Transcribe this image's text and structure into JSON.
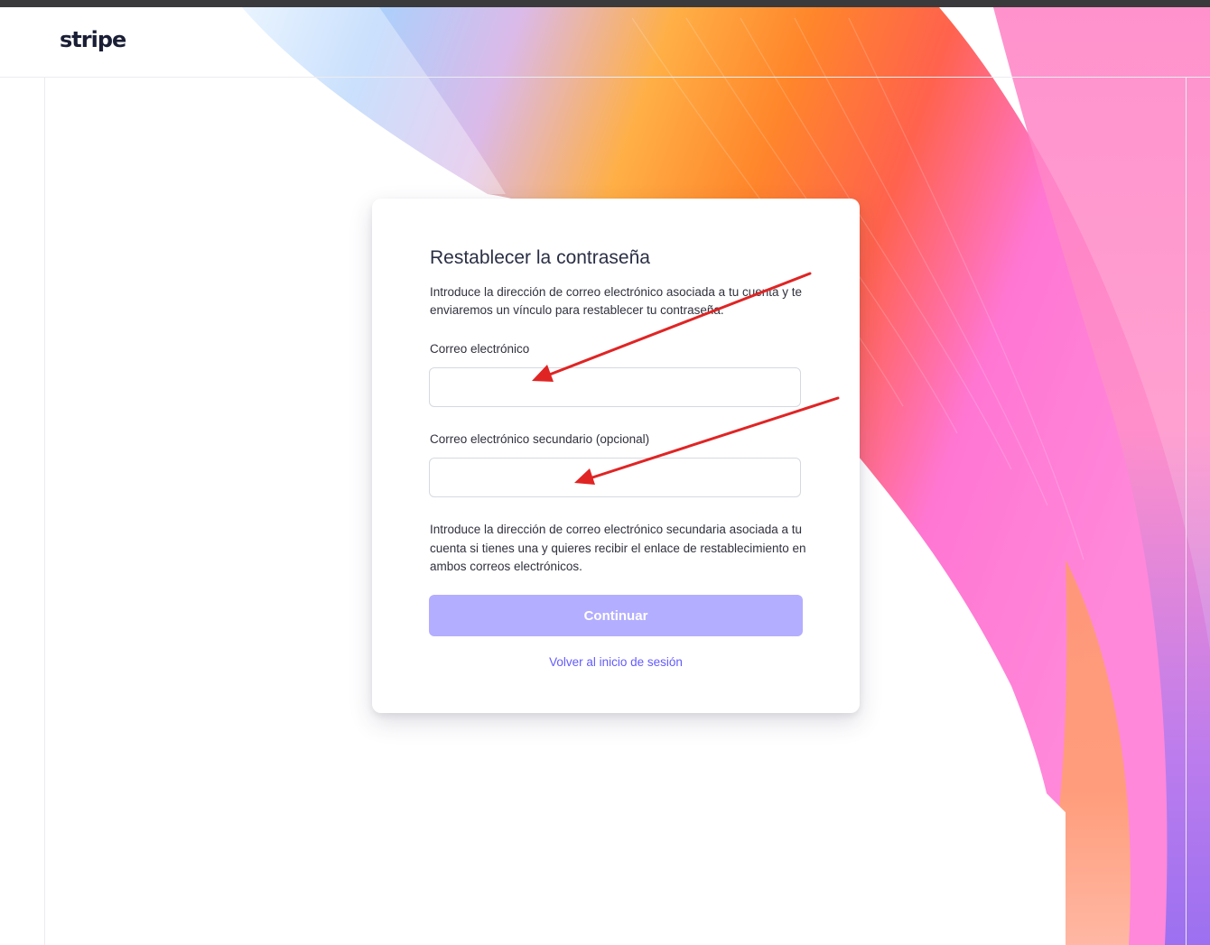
{
  "header": {
    "logo_text": "stripe"
  },
  "card": {
    "title": "Restablecer la contraseña",
    "description": "Introduce la dirección de correo electrónico asociada a tu cuenta y te enviaremos un vínculo para restablecer tu contraseña.",
    "email_label": "Correo electrónico",
    "email_value": "",
    "secondary_email_label": "Correo electrónico secundario (opcional)",
    "secondary_email_value": "",
    "secondary_help": "Introduce la dirección de correo electrónico secundaria asociada a tu cuenta si tienes una y quieres recibir el enlace de restablecimiento en ambos correos electrónicos.",
    "continue_label": "Continuar",
    "back_link_label": "Volver al inicio de sesión"
  },
  "colors": {
    "brand": "#635bff",
    "button_disabled": "#b3aeff",
    "annotation_arrow": "#e02424",
    "text": "#30313d"
  }
}
